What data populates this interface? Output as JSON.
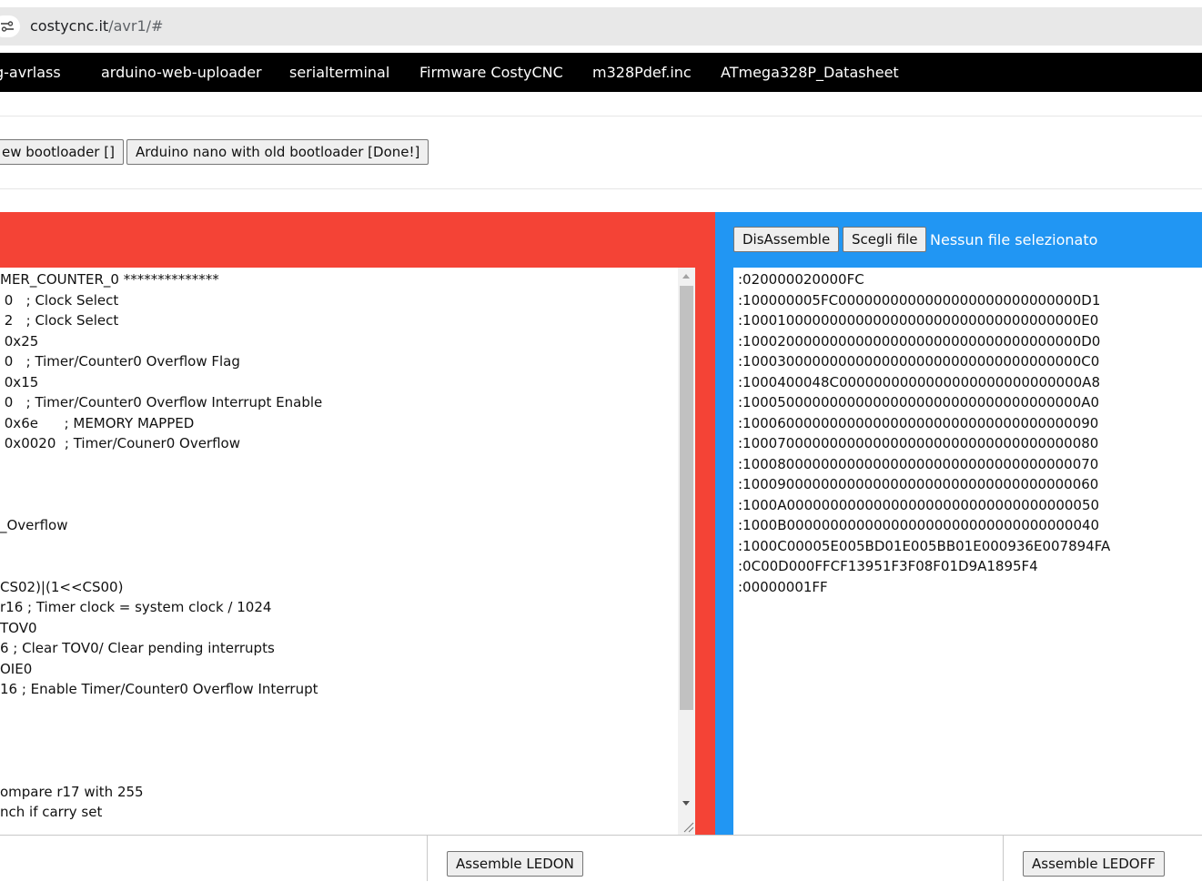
{
  "browser": {
    "url_host": "costycnc.it",
    "url_path": "/avr1/#"
  },
  "nav": {
    "items": [
      "g-avrlass",
      "arduino-web-uploader",
      "serialterminal",
      "Firmware CostyCNC",
      "m328Pdef.inc",
      "ATmega328P_Datasheet"
    ]
  },
  "board_buttons": {
    "new_bootloader": "ew bootloader []",
    "old_bootloader": "Arduino nano with old bootloader [Done!]"
  },
  "asm_editor": {
    "lines": [
      "MER_COUNTER_0 **************",
      " 0   ; Clock Select",
      " 2   ; Clock Select",
      " 0x25",
      " 0   ; Timer/Counter0 Overflow Flag",
      " 0x15",
      " 0   ; Timer/Counter0 Overflow Interrupt Enable",
      " 0x6e      ; MEMORY MAPPED",
      " 0x0020  ; Timer/Couner0 Overflow",
      "",
      "",
      "",
      "_Overflow",
      "",
      "",
      "CS02)|(1<<CS00)",
      "r16 ; Timer clock = system clock / 1024",
      "TOV0",
      "6 ; Clear TOV0/ Clear pending interrupts",
      "OIE0",
      "16 ; Enable Timer/Counter0 Overflow Interrupt",
      "",
      "",
      "",
      "",
      "ompare r17 with 255",
      "nch if carry set"
    ]
  },
  "hex_panel": {
    "disassemble_label": "DisAssemble",
    "choose_file_label": "Scegli file",
    "file_status": "Nessun file selezionato",
    "lines": [
      ":020000020000FC",
      ":100000005FC0000000000000000000000000000D1",
      ":100010000000000000000000000000000000000E0",
      ":100020000000000000000000000000000000000D0",
      ":100030000000000000000000000000000000000C0",
      ":1000400048C0000000000000000000000000000A8",
      ":100050000000000000000000000000000000000A0",
      ":10006000000000000000000000000000000000090",
      ":10007000000000000000000000000000000000080",
      ":10008000000000000000000000000000000000070",
      ":10009000000000000000000000000000000000060",
      ":1000A000000000000000000000000000000000050",
      ":1000B000000000000000000000000000000000040",
      ":1000C00005E005BD01E005BB01E000936E007894FA",
      ":0C00D000FFCF13951F3F08F01D9A1895F4",
      ":00000001FF"
    ]
  },
  "bottom": {
    "assemble_ledon": "Assemble LEDON",
    "assemble_ledoff": "Assemble LEDOFF"
  }
}
